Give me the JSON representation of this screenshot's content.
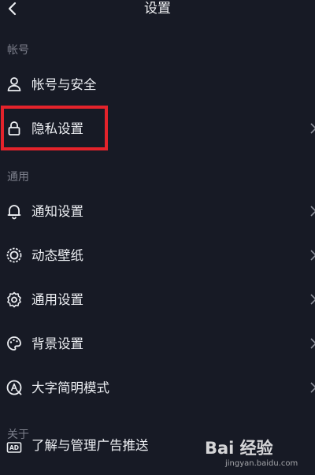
{
  "header": {
    "title": "设置"
  },
  "sections": [
    {
      "label": "帐号"
    },
    {
      "label": "通用"
    },
    {
      "label": "关于"
    }
  ],
  "rows": [
    {
      "label": "帐号与安全",
      "icon": "person-icon"
    },
    {
      "label": "隐私设置",
      "icon": "lock-icon"
    },
    {
      "label": "通知设置",
      "icon": "bell-icon"
    },
    {
      "label": "动态壁纸",
      "icon": "dynamic-wallpaper-icon"
    },
    {
      "label": "通用设置",
      "icon": "gear-icon"
    },
    {
      "label": "背景设置",
      "icon": "palette-icon"
    },
    {
      "label": "大字简明模式",
      "icon": "large-text-icon"
    },
    {
      "label": "了解与管理广告推送",
      "icon": "ad-icon"
    }
  ],
  "watermark": {
    "logo": "Bai 经验",
    "url": "jingyan.baidu.com"
  },
  "colors": {
    "background": "#171a25",
    "highlight": "#e4232b",
    "section_label": "#7c7f8b"
  }
}
